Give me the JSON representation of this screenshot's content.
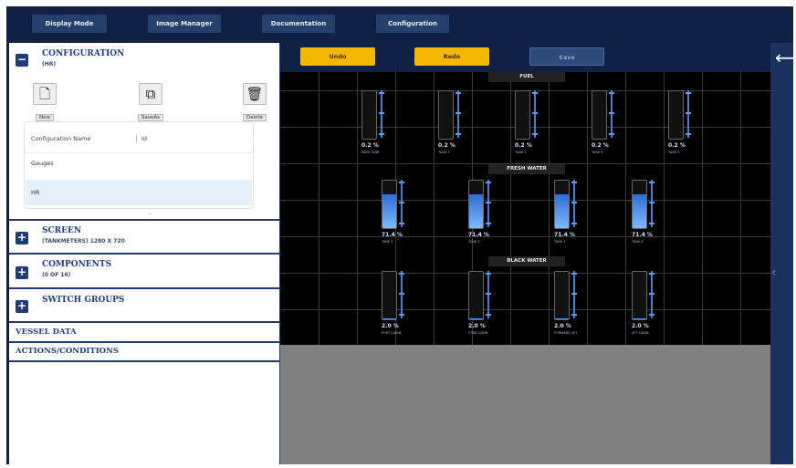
{
  "top_nav": {
    "display_mode": "Display Mode",
    "image_manager": "Image Manager",
    "documentation": "Documentation",
    "configuration": "Configuration"
  },
  "configuration": {
    "title": "CONFIGURATION",
    "subtitle": "(HR)",
    "tools": {
      "new": "New",
      "save_as": "SaveAs",
      "delete": "Delete"
    },
    "table": {
      "headers": [
        "Configuration Name",
        "Id"
      ],
      "rows": [
        "Gauges",
        "HR"
      ]
    }
  },
  "screen": {
    "title": "SCREEN",
    "subtitle": "(TANKMETERS) 1280 X 720"
  },
  "components": {
    "title": "COMPONENTS",
    "subtitle": "(0 OF 16)"
  },
  "switch_groups": {
    "title": "SWITCH GROUPS"
  },
  "vessel_data": {
    "title": "VESSEL DATA"
  },
  "actions_conditions": {
    "title": "ACTIONS/CONDITIONS"
  },
  "controls": {
    "undo": "Undo",
    "redo": "Redo",
    "save": "Save"
  },
  "colors": {
    "undo_redo": "#f5b800",
    "save": "#2e4a7a",
    "nav": "#0f2246",
    "panel_border": "#1d3c78"
  },
  "icons": {
    "back": "arrow-left-icon",
    "new": "new-file-icon",
    "save_as": "copy-icon",
    "delete": "trash-icon"
  },
  "groups": [
    {
      "label": "FUEL",
      "gauges": [
        {
          "value": "0.2 %",
          "level": 0.002,
          "name": "MAIN TANK"
        },
        {
          "value": "0.2 %",
          "level": 0.002,
          "name": "TANK 2"
        },
        {
          "value": "0.2 %",
          "level": 0.002,
          "name": "TANK 3"
        },
        {
          "value": "0.2 %",
          "level": 0.002,
          "name": "TANK 4"
        },
        {
          "value": "0.2 %",
          "level": 0.002,
          "name": "TANK 5"
        }
      ]
    },
    {
      "label": "FRESH WATER",
      "gauges": [
        {
          "value": "71.4 %",
          "level": 0.714,
          "name": "TANK 1"
        },
        {
          "value": "71.4 %",
          "level": 0.714,
          "name": "TANK 2"
        },
        {
          "value": "71.4 %",
          "level": 0.714,
          "name": "TANK 3"
        },
        {
          "value": "71.4 %",
          "level": 0.714,
          "name": "TANK 4"
        }
      ]
    },
    {
      "label": "BLACK WATER",
      "gauges": [
        {
          "value": "2.0 %",
          "level": 0.02,
          "name": "PORT CABIN"
        },
        {
          "value": "2.0 %",
          "level": 0.02,
          "name": "STBD CABIN"
        },
        {
          "value": "2.0 %",
          "level": 0.02,
          "name": "FORWARD AFT"
        },
        {
          "value": "2.0 %",
          "level": 0.02,
          "name": "AFT CABIN"
        }
      ]
    }
  ]
}
